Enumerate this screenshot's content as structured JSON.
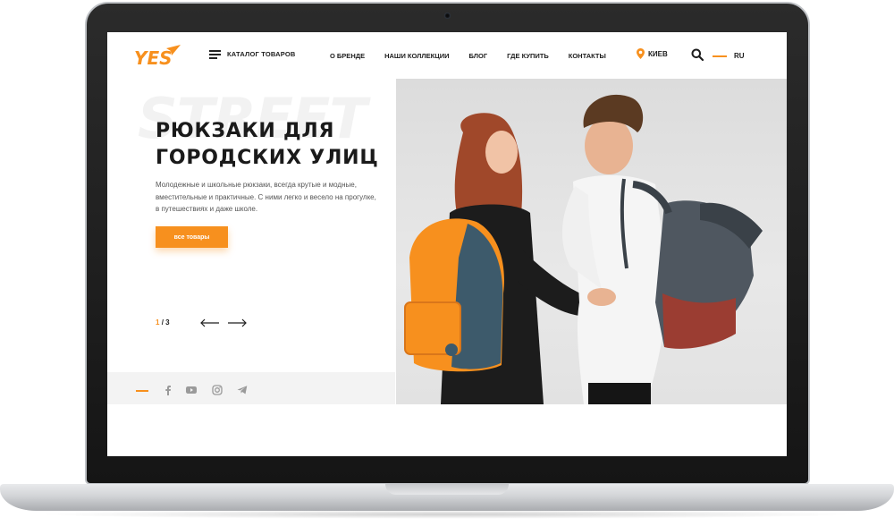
{
  "header": {
    "logo_text": "YES",
    "catalog_label": "КАТАЛОГ ТОВАРОВ",
    "nav": [
      "О БРЕНДЕ",
      "НАШИ КОЛЛЕКЦИИ",
      "БЛОГ",
      "ГДЕ КУПИТЬ",
      "КОНТАКТЫ"
    ],
    "city": "КИЕВ",
    "lang": "RU"
  },
  "hero": {
    "background_word": "STREET",
    "title": "РЮКЗАКИ ДЛЯ ГОРОДСКИХ УЛИЦ",
    "description": "Молодежные и школьные рюкзаки, всегда крутые и модные, вместительные и практичные. С ними легко и весело на прогулке, в путешествиях и даже школе.",
    "cta_label": "все товары",
    "slide_current": "1",
    "slide_total": "/ 3"
  },
  "social": {
    "icons": [
      "facebook-icon",
      "youtube-icon",
      "instagram-icon",
      "telegram-icon"
    ]
  },
  "colors": {
    "accent": "#f7901e",
    "text": "#1d1d1d",
    "muted_bg": "#f3f3f3"
  }
}
